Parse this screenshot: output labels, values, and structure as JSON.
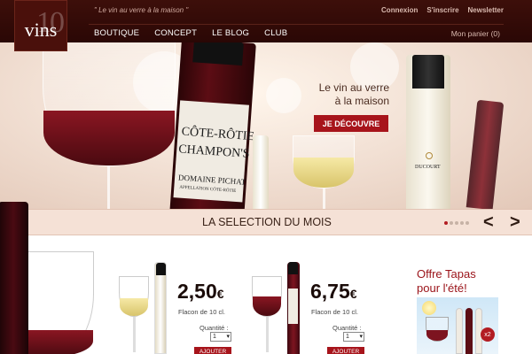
{
  "header": {
    "logo_text": "vins",
    "logo_number": "10",
    "tagline": "\" Le vin au verre à la maison \"",
    "top_links": [
      "Connexion",
      "S'inscrire",
      "Newsletter"
    ],
    "nav": [
      "BOUTIQUE",
      "CONCEPT",
      "LE BLOG",
      "CLUB"
    ],
    "cart": "Mon panier (0)"
  },
  "hero": {
    "line1": "Le vin au verre",
    "line2": "à la maison",
    "cta": "JE DÉCOUVRE",
    "bottle_label_1": "CÔTE-RÔTIE",
    "bottle_label_2": "CHAMPON'S",
    "bottle_label_3": "DOMAINE PICHAT",
    "bottle_label_4": "APPELLATION CÔTE-RÔTIE",
    "bottle_label_5": "DUCOURT"
  },
  "selection": {
    "title": "LA SELECTION DU MOIS",
    "prev": "<",
    "next": ">",
    "active_dot": 0,
    "dot_count": 5
  },
  "products": [
    {
      "price": "2,50",
      "currency": "€",
      "format": "Flacon de 10 cl.",
      "qty_label": "Quantité :",
      "qty": "1",
      "add": "AJOUTER"
    },
    {
      "price": "6,75",
      "currency": "€",
      "format": "Flacon de 10 cl.",
      "qty_label": "Quantité :",
      "qty": "1",
      "add": "AJOUTER"
    }
  ],
  "promo": {
    "title_line1": "Offre Tapas",
    "title_line2": "pour l'été!",
    "badge": "x2"
  },
  "colors": {
    "header_bg": "#3d0f0a",
    "accent_red": "#a7141b",
    "band_bg": "#f5e1d6"
  }
}
